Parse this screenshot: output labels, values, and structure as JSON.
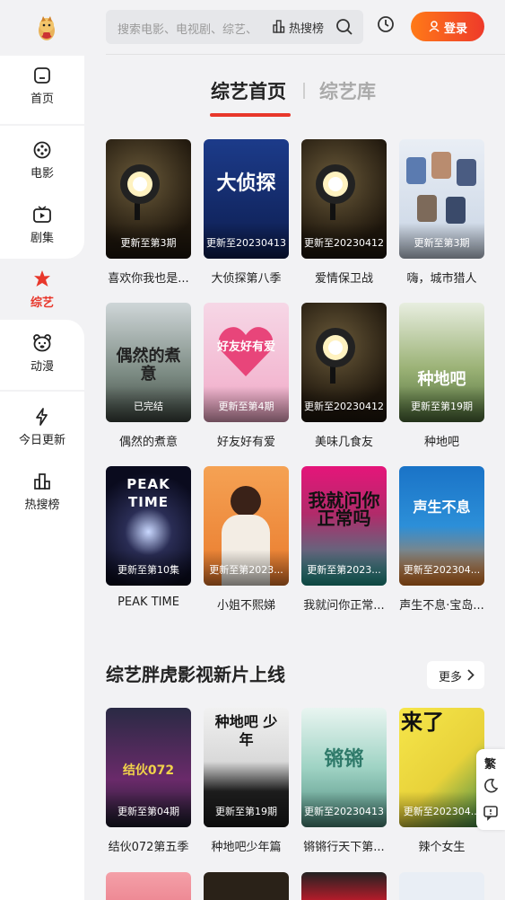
{
  "sidebar": {
    "items": [
      {
        "label": "首页",
        "icon": "home-icon"
      },
      {
        "label": "电影",
        "icon": "film-reel-icon"
      },
      {
        "label": "剧集",
        "icon": "tv-icon"
      },
      {
        "label": "综艺",
        "icon": "star-icon",
        "active": true
      },
      {
        "label": "动漫",
        "icon": "bear-icon"
      },
      {
        "label": "今日更新",
        "icon": "lightning-icon"
      },
      {
        "label": "热搜榜",
        "icon": "chart-icon"
      }
    ]
  },
  "header": {
    "search_placeholder": "搜索电影、电视剧、综艺、",
    "hot_label": "热搜榜",
    "login_label": "登录"
  },
  "tabs": [
    {
      "label": "综艺首页",
      "active": true
    },
    {
      "label": "综艺库",
      "active": false
    }
  ],
  "grid": [
    {
      "title": "喜欢你我也是...",
      "badge": "更新至第3期",
      "theme": "spotlight"
    },
    {
      "title": "大侦探第八季",
      "badge": "更新至20230413",
      "theme": "blue"
    },
    {
      "title": "爱情保卫战",
      "badge": "更新至20230412",
      "theme": "spotlight"
    },
    {
      "title": "嗨，城市猎人",
      "badge": "更新至第3期",
      "theme": "white"
    },
    {
      "title": "偶然的煮意",
      "badge": "已完结",
      "theme": "mountain"
    },
    {
      "title": "好友好有爱",
      "badge": "更新至第4期",
      "theme": "pink"
    },
    {
      "title": "美味几食友",
      "badge": "更新至20230412",
      "theme": "spotlight"
    },
    {
      "title": "种地吧",
      "badge": "更新至第19期",
      "theme": "field"
    },
    {
      "title": "PEAK TIME",
      "badge": "更新至第10集",
      "theme": "dark"
    },
    {
      "title": "小姐不熙娣",
      "badge": "更新至第2023...",
      "theme": "orange"
    },
    {
      "title": "我就问你正常...",
      "badge": "更新至第2023...",
      "theme": "neon"
    },
    {
      "title": "声生不息·宝岛...",
      "badge": "更新至202304...",
      "theme": "stage"
    }
  ],
  "section": {
    "title": "综艺胖虎影视新片上线",
    "more_label": "更多"
  },
  "section_grid": [
    {
      "title": "结伙072第五季",
      "badge": "更新至第04期",
      "theme": "dark"
    },
    {
      "title": "种地吧少年篇",
      "badge": "更新至第19期",
      "theme": "bw"
    },
    {
      "title": "锵锵行天下第...",
      "badge": "更新至20230413",
      "theme": "teal"
    },
    {
      "title": "辣个女生",
      "badge": "更新至202304...",
      "theme": "yellow"
    }
  ],
  "float_panel": {
    "label": "繁"
  },
  "poster_texts": {
    "p2": "大侦探",
    "p5": "偶然的煮意",
    "p6": "好友好有爱",
    "p8": "种地吧",
    "p9": "PEAK TIME",
    "p11": "我就问你正常吗",
    "p12": "声生不息",
    "s1": "结伙072",
    "s2": "种地吧 少年",
    "s3": "锵锵",
    "s4": "来了"
  },
  "colors": {
    "accent": "#e8372b",
    "login_start": "#ff7a18",
    "login_end": "#ee3a2a"
  }
}
